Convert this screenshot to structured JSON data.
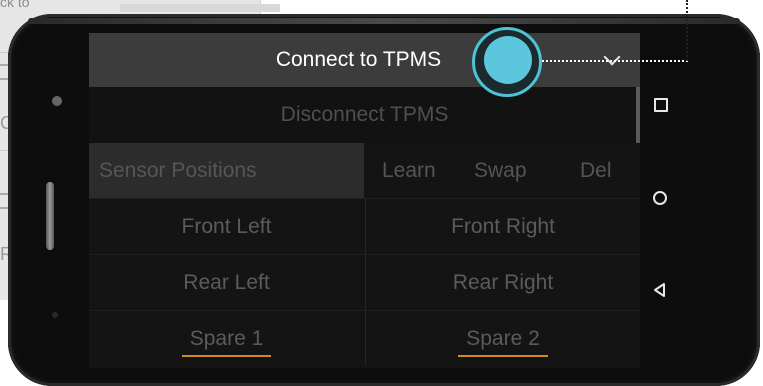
{
  "background_app": {
    "top_text": "ck to",
    "side_letters": [
      "CA",
      "RO"
    ]
  },
  "screen": {
    "connect_label": "Connect to TPMS",
    "disconnect_label": "Disconnect TPMS",
    "sensor_header": "Sensor Positions",
    "actions": {
      "learn": "Learn",
      "swap": "Swap",
      "del": "Del"
    },
    "positions": {
      "front_left": "Front Left",
      "front_right": "Front Right",
      "rear_left": "Rear Left",
      "rear_right": "Rear Right",
      "spare1": "Spare 1",
      "spare2": "Spare 2"
    }
  },
  "nav": {
    "icons": [
      "recents-square-icon",
      "home-circle-icon",
      "back-triangle-icon"
    ]
  },
  "colors": {
    "accent_touch": "#5cc6df",
    "spare_underline": "#d08a1e"
  }
}
